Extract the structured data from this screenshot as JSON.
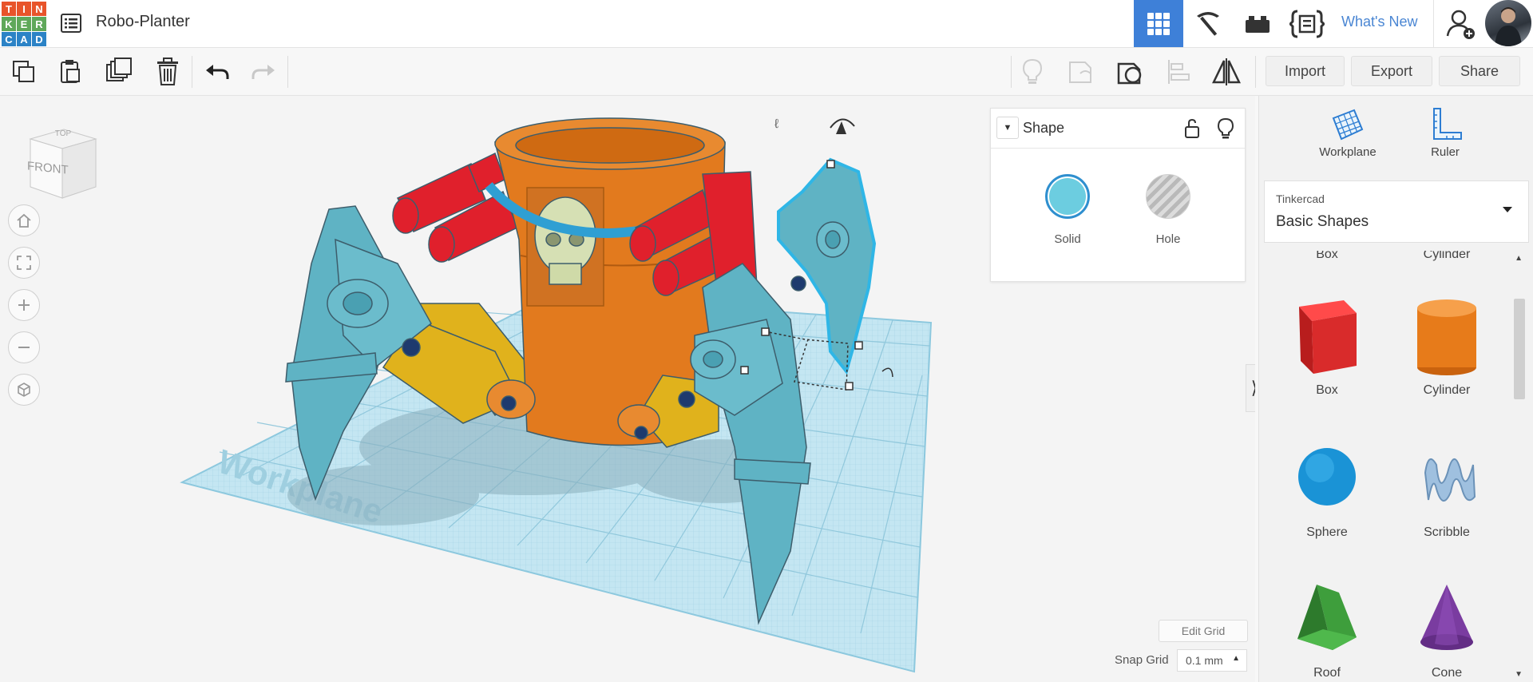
{
  "app": {
    "logo_letters": [
      "T",
      "I",
      "N",
      "K",
      "E",
      "R",
      "C",
      "A",
      "D"
    ],
    "design_title": "Robo-Planter"
  },
  "header": {
    "whats_new": "What's New",
    "icons": [
      "grid-view-icon",
      "build-pickaxe-icon",
      "bricks-icon",
      "codeblocks-icon",
      "add-user-icon",
      "avatar"
    ]
  },
  "toolbar": {
    "tools": [
      "copy",
      "paste",
      "duplicate",
      "delete",
      "undo",
      "redo"
    ],
    "view_tools": [
      "show-notes",
      "hide",
      "show-all",
      "align",
      "mirror"
    ],
    "import_label": "Import",
    "export_label": "Export",
    "share_label": "Share"
  },
  "viewport": {
    "view_cube_front": "FRONT",
    "view_cube_top": "TOP",
    "workplane_watermark": "Workplane",
    "edit_grid_label": "Edit Grid",
    "snap_grid_label": "Snap Grid",
    "snap_grid_value": "0.1 mm"
  },
  "inspector": {
    "title": "Shape",
    "solid_label": "Solid",
    "hole_label": "Hole",
    "solid_color": "#6ccde0"
  },
  "right_panel": {
    "workplane_label": "Workplane",
    "ruler_label": "Ruler",
    "library_source": "Tinkercad",
    "library_name": "Basic Shapes",
    "partial_row": [
      "Box",
      "Cylinder"
    ],
    "shapes": [
      {
        "label": "Box",
        "color": "#d92b2b"
      },
      {
        "label": "Cylinder",
        "color": "#e77b1a"
      },
      {
        "label": "Sphere",
        "color": "#1a93d6"
      },
      {
        "label": "Scribble",
        "color": "#8fb4d8"
      },
      {
        "label": "Roof",
        "color": "#3e9e3c"
      },
      {
        "label": "Cone",
        "color": "#7a3ca0"
      }
    ]
  },
  "colors": {
    "accent": "#3e80d8",
    "robot_teal": "#5fb3c4",
    "robot_orange": "#e27a1e",
    "robot_red": "#e0202c",
    "robot_yellow": "#e0b21c",
    "grid_blue": "#b8e0ee"
  }
}
